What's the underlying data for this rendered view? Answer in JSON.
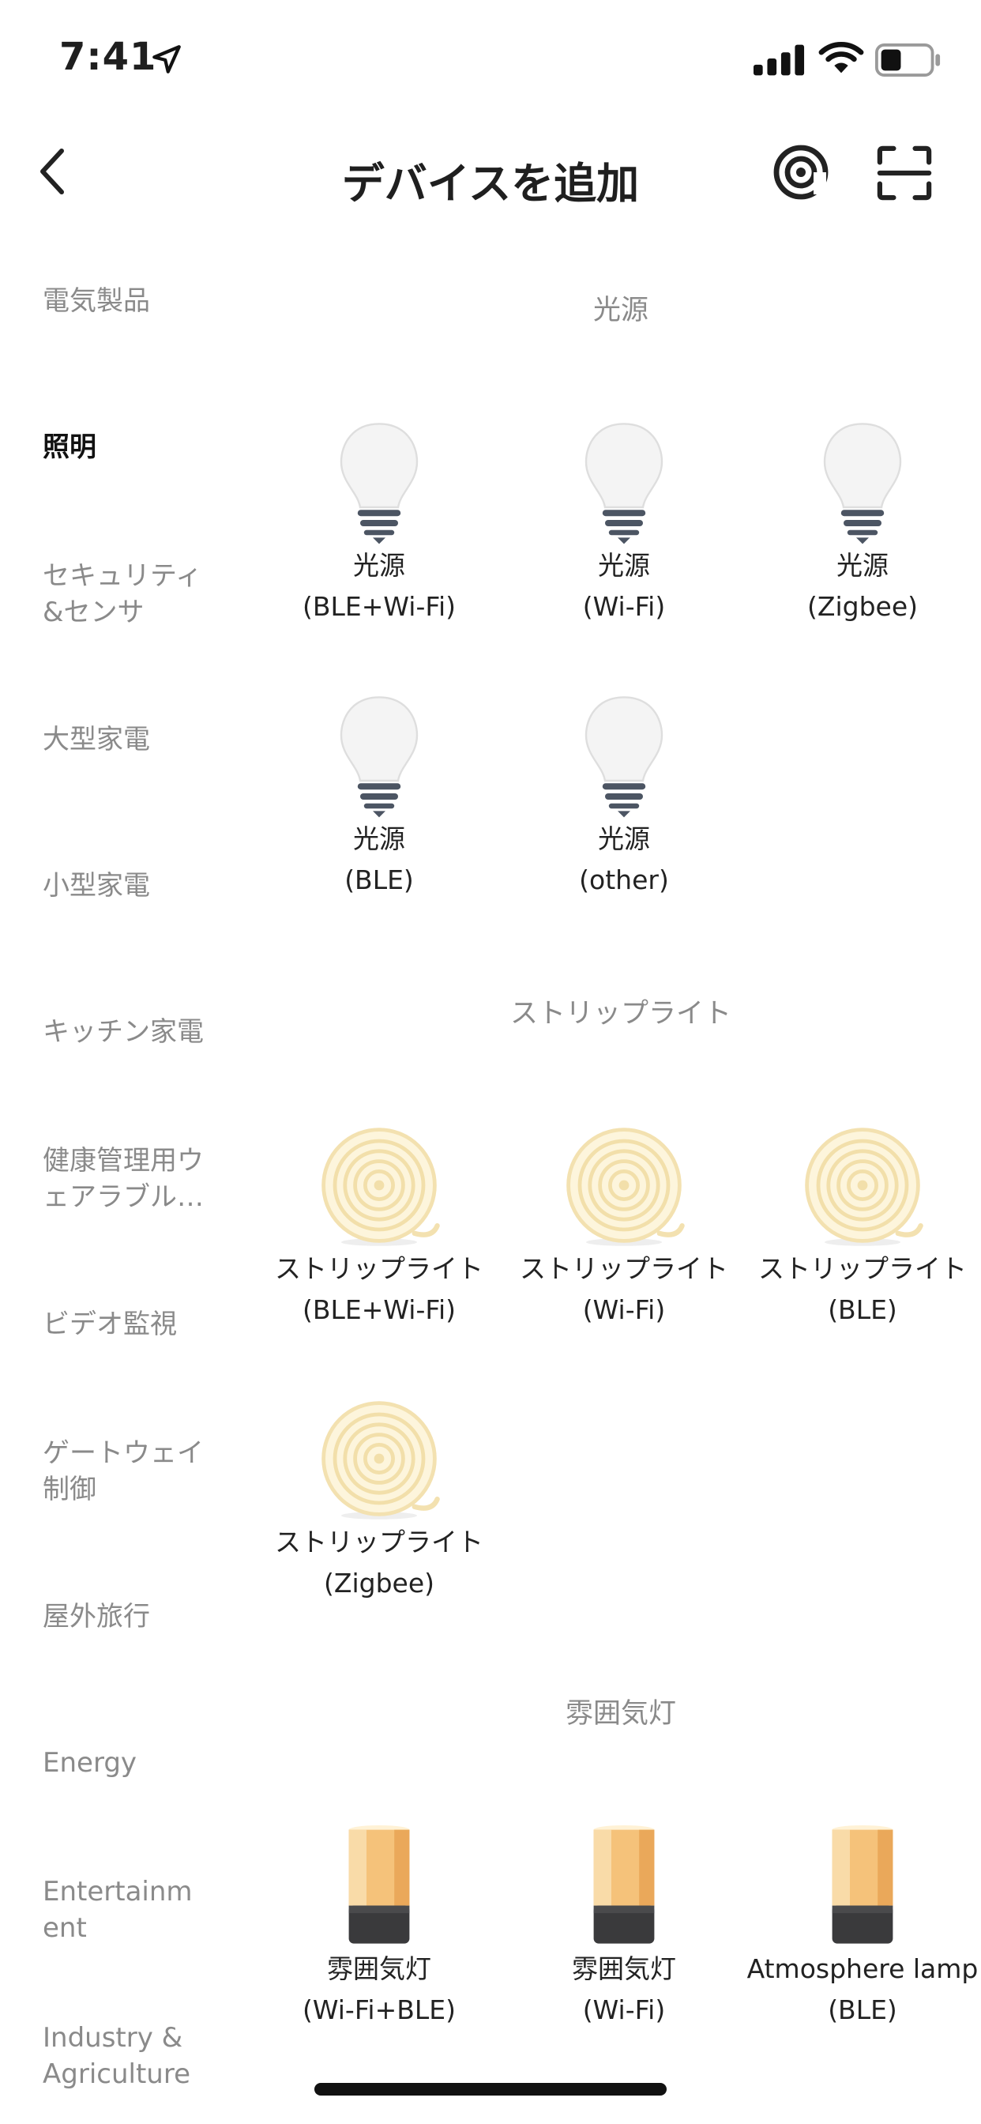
{
  "status_bar": {
    "time": "7:41"
  },
  "header": {
    "title": "デバイスを追加"
  },
  "sidebar": {
    "items": [
      {
        "lines": [
          "電気製品"
        ]
      },
      {
        "lines": [
          "照明"
        ]
      },
      {
        "lines": [
          "セキュリティ",
          "&センサ"
        ]
      },
      {
        "lines": [
          "大型家電"
        ]
      },
      {
        "lines": [
          "小型家電"
        ]
      },
      {
        "lines": [
          "キッチン家電"
        ]
      },
      {
        "lines": [
          "健康管理用ウ",
          "ェアラブル…"
        ]
      },
      {
        "lines": [
          "ビデオ監視"
        ]
      },
      {
        "lines": [
          "ゲートウェイ",
          "制御"
        ]
      },
      {
        "lines": [
          "屋外旅行"
        ]
      },
      {
        "lines": [
          "Energy"
        ]
      },
      {
        "lines": [
          "Entertainm",
          "ent"
        ]
      },
      {
        "lines": [
          "Industry &",
          "Agriculture"
        ]
      }
    ]
  },
  "sections": [
    {
      "title": "光源",
      "icon": "light-bulb-icon",
      "items": [
        {
          "name": "光源",
          "sub": "(BLE+Wi-Fi)"
        },
        {
          "name": "光源",
          "sub": "(Wi-Fi)"
        },
        {
          "name": "光源",
          "sub": "(Zigbee)"
        },
        {
          "name": "光源",
          "sub": "(BLE)"
        },
        {
          "name": "光源",
          "sub": "(other)"
        }
      ]
    },
    {
      "title": "ストリップライト",
      "icon": "strip-light-icon",
      "items": [
        {
          "name": "ストリップライト",
          "sub": "(BLE+Wi-Fi)"
        },
        {
          "name": "ストリップライト",
          "sub": "(Wi-Fi)"
        },
        {
          "name": "ストリップライト",
          "sub": "(BLE)"
        },
        {
          "name": "ストリップライト",
          "sub": "(Zigbee)"
        }
      ]
    },
    {
      "title": "雰囲気灯",
      "icon": "atmosphere-lamp-icon",
      "items": [
        {
          "name": "雰囲気灯",
          "sub": "(Wi-Fi+BLE)"
        },
        {
          "name": "雰囲気灯",
          "sub": "(Wi-Fi)"
        },
        {
          "name": "Atmosphere lamp",
          "sub": "(BLE)"
        }
      ]
    }
  ]
}
